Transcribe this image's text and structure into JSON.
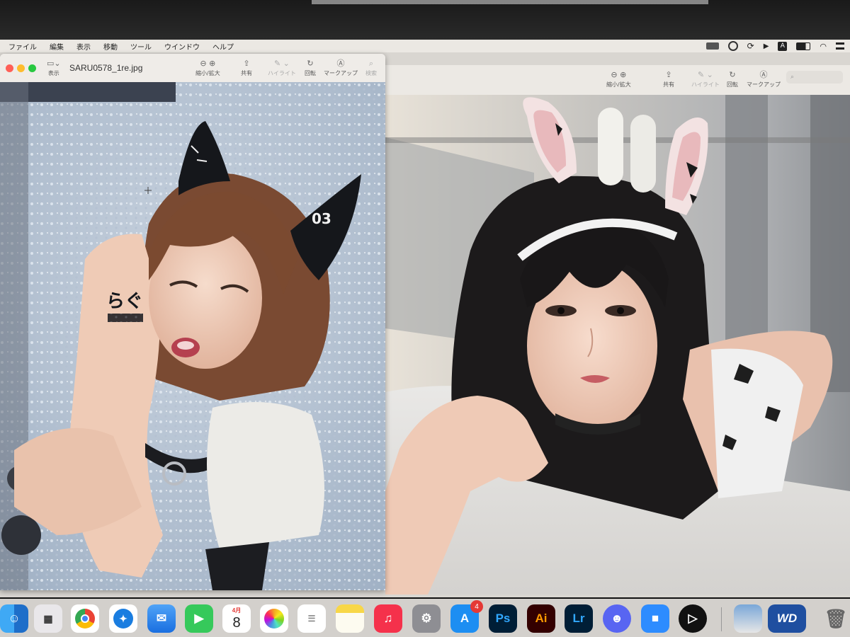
{
  "menubar": {
    "items": [
      "ファイル",
      "編集",
      "表示",
      "移動",
      "ツール",
      "ウインドウ",
      "ヘルプ"
    ],
    "status_icons": [
      "screen-recording-icon",
      "creative-cloud-icon",
      "sync-icon",
      "play-icon",
      "text-input-icon",
      "battery-icon",
      "wifi-icon",
      "control-center-icon"
    ],
    "input_source_label": "A"
  },
  "window1": {
    "title": "SARU0578_1re.jpg",
    "view_label": "表示",
    "toolbar": {
      "zoom_label": "縮小/拡大",
      "share_label": "共有",
      "highlight_label": "ハイライト",
      "rotate_label": "回転",
      "markup_label": "マークアップ",
      "search_label": "検索"
    },
    "photo": {
      "hand_mark_text": "らぐ",
      "ear_number": "03"
    }
  },
  "window2": {
    "toolbar": {
      "zoom_label": "縮小/拡大",
      "share_label": "共有",
      "highlight_label": "ハイライト",
      "rotate_label": "回転",
      "markup_label": "マークアップ"
    }
  },
  "dock": {
    "calendar_month": "4月",
    "calendar_day": "8",
    "appstore_badge": "4",
    "apps": [
      {
        "name": "finder-icon"
      },
      {
        "name": "launchpad-icon"
      },
      {
        "name": "chrome-icon"
      },
      {
        "name": "safari-icon"
      },
      {
        "name": "mail-icon"
      },
      {
        "name": "facetime-icon"
      },
      {
        "name": "calendar-icon"
      },
      {
        "name": "photos-icon"
      },
      {
        "name": "reminders-icon"
      },
      {
        "name": "notes-icon"
      },
      {
        "name": "music-icon"
      },
      {
        "name": "system-settings-icon"
      },
      {
        "name": "app-store-icon"
      },
      {
        "name": "photoshop-icon",
        "label": "Ps"
      },
      {
        "name": "illustrator-icon",
        "label": "Ai"
      },
      {
        "name": "lightroom-icon",
        "label": "Lr"
      },
      {
        "name": "discord-icon"
      },
      {
        "name": "zoom-icon"
      },
      {
        "name": "infuse-icon"
      },
      {
        "name": "preview-folder-icon"
      },
      {
        "name": "wd-drive-icon",
        "label": "WD"
      },
      {
        "name": "trash-icon"
      }
    ]
  },
  "colors": {
    "menubar_bg": "#ebe8e3",
    "close": "#ff5f57",
    "minimize": "#febc2e",
    "zoom": "#28c840",
    "dock_bg": "#d3d0cc"
  }
}
